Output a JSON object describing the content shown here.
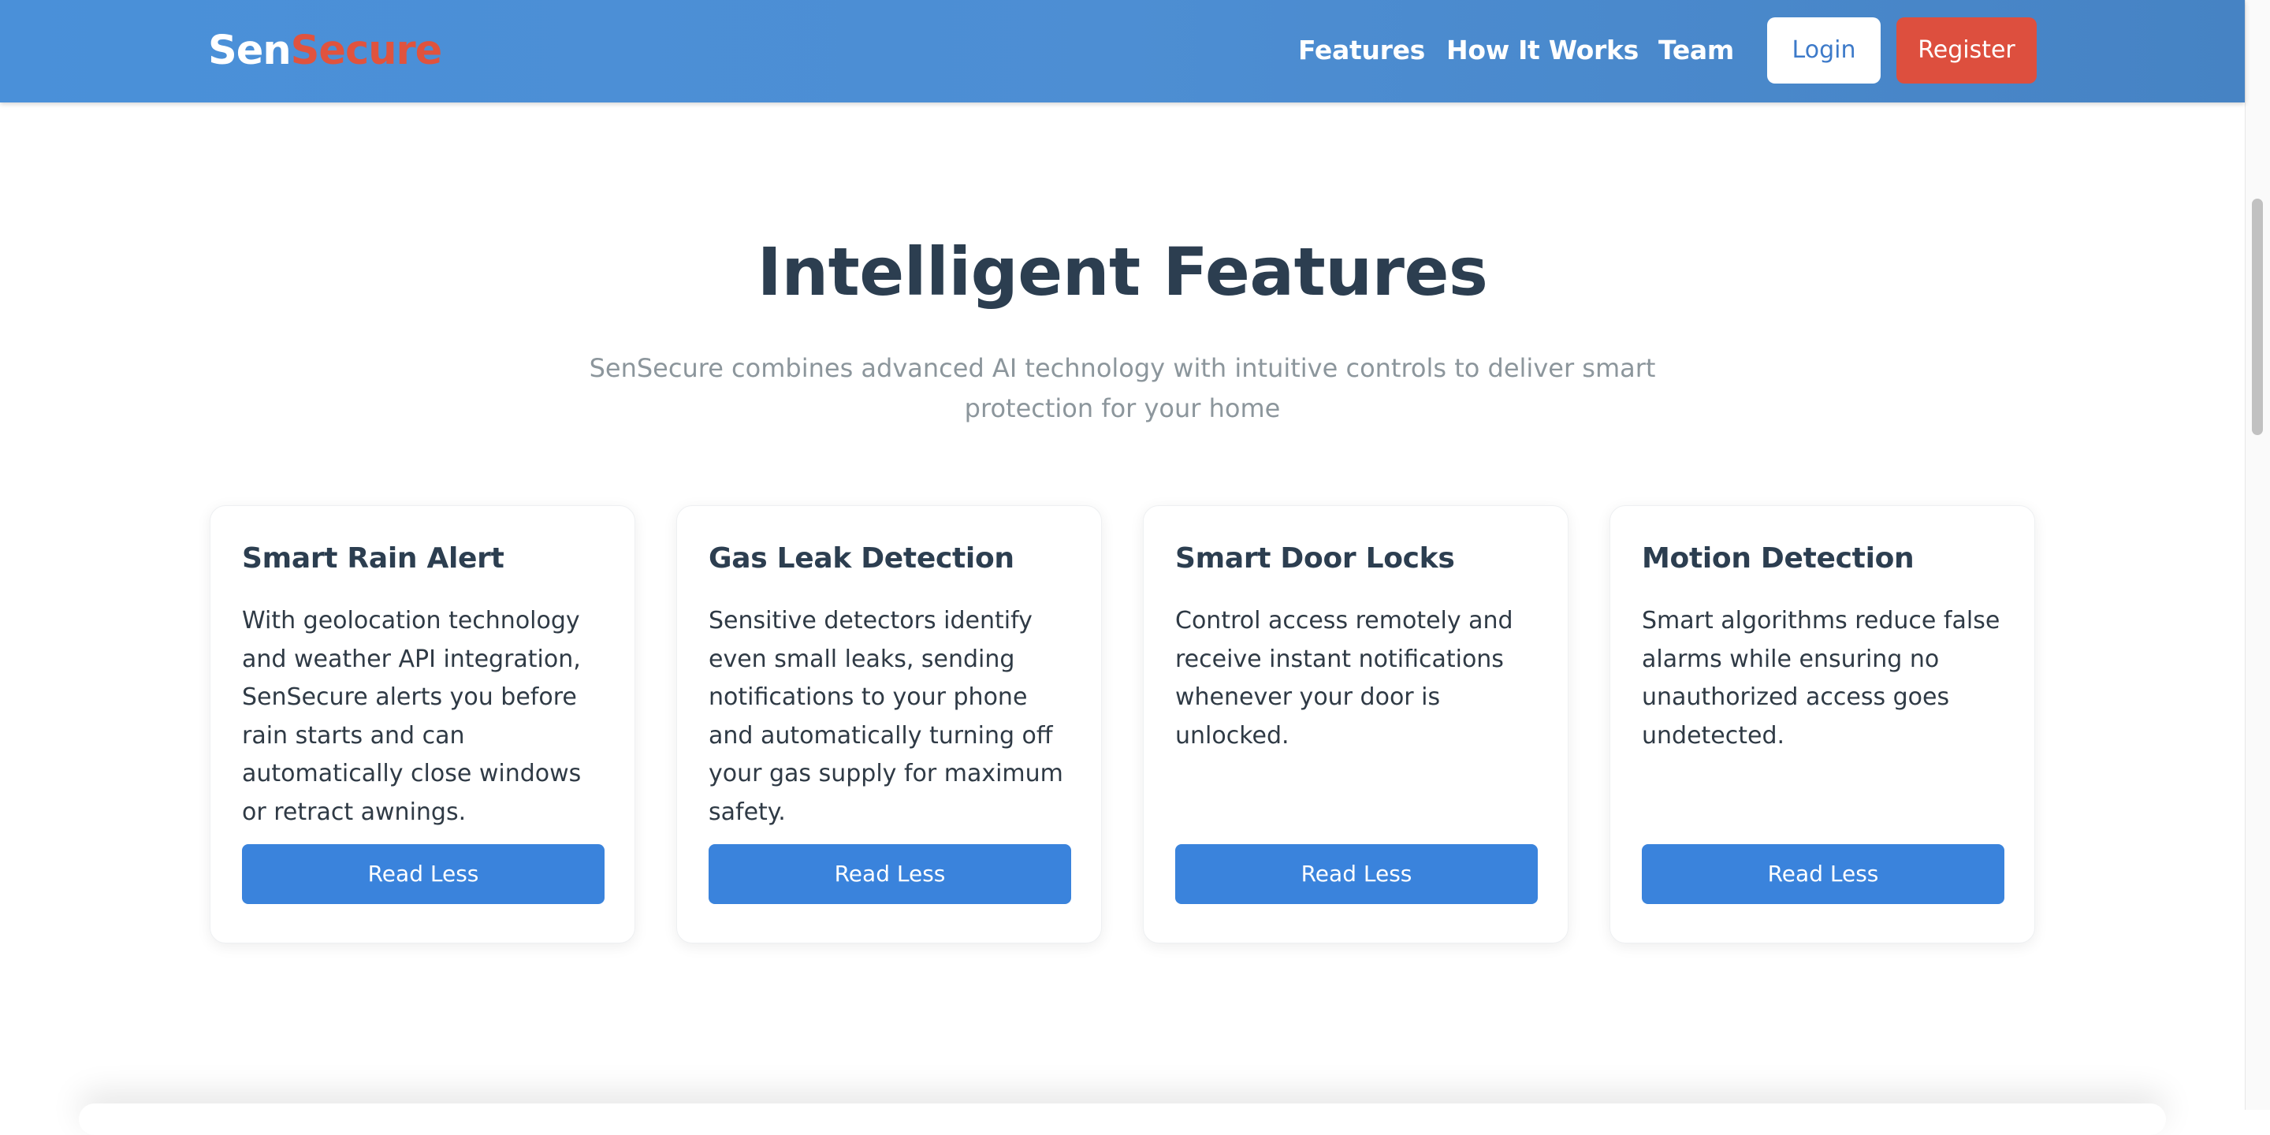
{
  "navbar": {
    "brand_part1": "Sen",
    "brand_part2": "Secure",
    "links": [
      "Features",
      "How It Works",
      "Team"
    ],
    "login_label": "Login",
    "register_label": "Register"
  },
  "features_section": {
    "title": "Intelligent Features",
    "subtitle": "SenSecure combines advanced AI technology with intuitive controls to deliver smart protection for your home",
    "cards": [
      {
        "title": "Smart Rain Alert",
        "description": "With geolocation technology and weather API integration, SenSecure alerts you before rain starts and can automatically close windows or retract awnings.",
        "button_label": "Read Less"
      },
      {
        "title": "Gas Leak Detection",
        "description": "Sensitive detectors identify even small leaks, sending notifications to your phone and automatically turning off your gas supply for maximum safety.",
        "button_label": "Read Less"
      },
      {
        "title": "Smart Door Locks",
        "description": "Control access remotely and receive instant notifications whenever your door is unlocked.",
        "button_label": "Read Less"
      },
      {
        "title": "Motion Detection",
        "description": "Smart algorithms reduce false alarms while ensuring no unauthorized access goes undetected.",
        "button_label": "Read Less"
      }
    ]
  },
  "colors": {
    "header_blue": "#4a90d9",
    "brand_red": "#e0533e",
    "register_red": "#dd4f3e",
    "button_blue": "#3a83dc",
    "heading_dark": "#2c3e50",
    "subtitle_gray": "#8c969c"
  }
}
